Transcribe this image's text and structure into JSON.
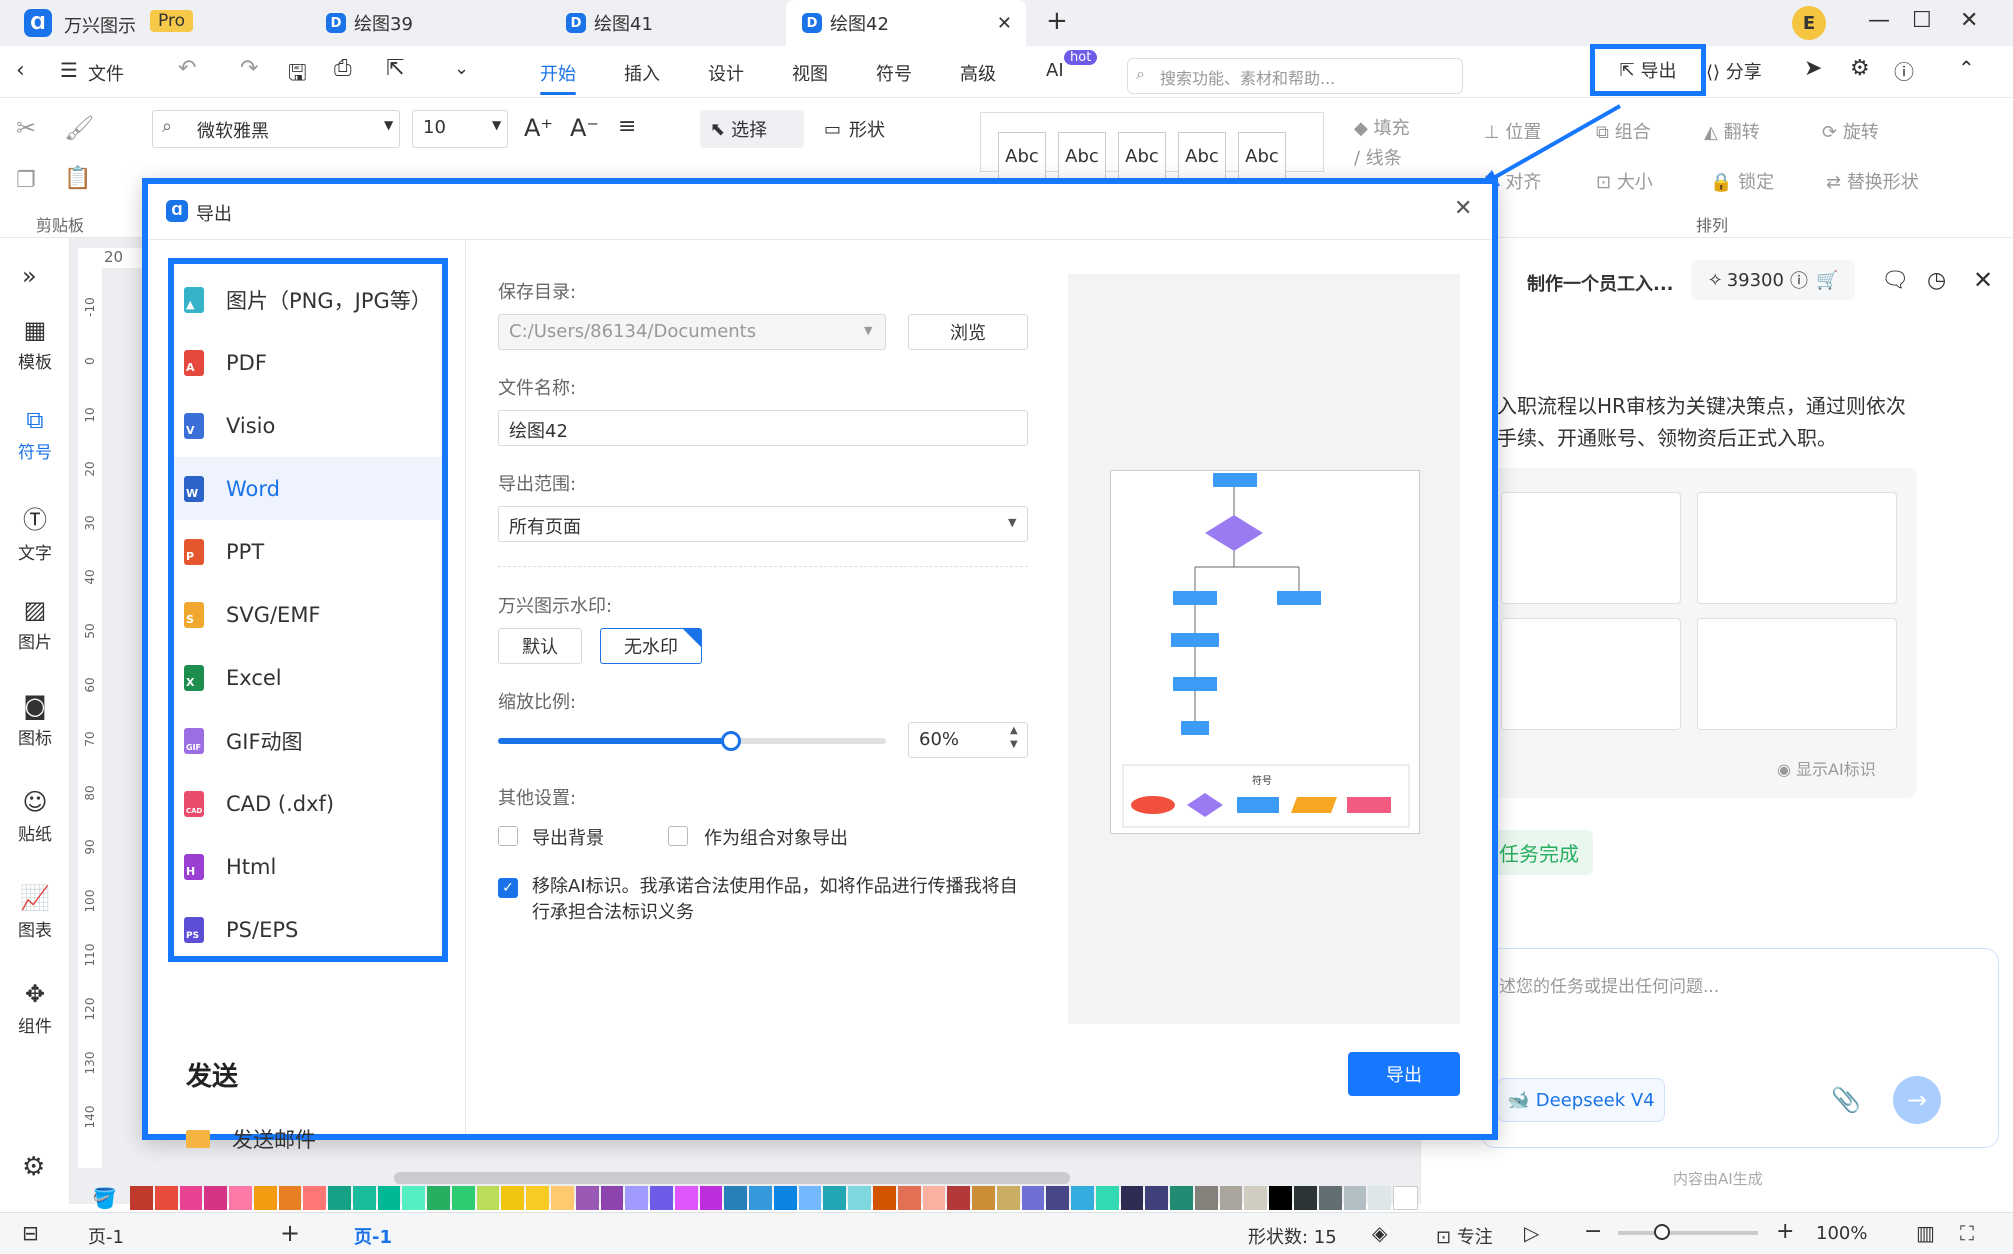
{
  "titlebar": {
    "app_name": "万兴图示",
    "pro_badge": "Pro",
    "tabs": [
      {
        "label": "绘图39"
      },
      {
        "label": "绘图41"
      },
      {
        "label": "绘图42"
      }
    ],
    "new_tab": "+",
    "avatar": "E"
  },
  "menubar": {
    "file": "文件",
    "items": [
      "开始",
      "插入",
      "设计",
      "视图",
      "符号",
      "高级",
      "AI"
    ],
    "hot_badge": "hot",
    "search_placeholder": "搜索功能、素材和帮助...",
    "export": "导出",
    "share": "分享"
  },
  "ribbon": {
    "clipboard": "剪贴板",
    "font_name": "微软雅黑",
    "font_size": "10",
    "select": "选择",
    "shape": "形状",
    "style_samples": [
      "Abc",
      "Abc",
      "Abc",
      "Abc",
      "Abc"
    ],
    "fill": "填充",
    "line": "线条",
    "position": "位置",
    "group": "组合",
    "flip": "翻转",
    "rotate": "旋转",
    "align": "对齐",
    "size": "大小",
    "lock": "锁定",
    "replace_shape": "替换形状",
    "arrange": "排列"
  },
  "leftbar": {
    "items": [
      "模板",
      "符号",
      "文字",
      "图片",
      "图标",
      "贴纸",
      "图表",
      "组件"
    ]
  },
  "ruler": {
    "top_label": "20",
    "marks": [
      "-10",
      "0",
      "10",
      "20",
      "30",
      "40",
      "50",
      "60",
      "70",
      "80",
      "90",
      "100",
      "110",
      "120",
      "130",
      "140"
    ]
  },
  "dialog": {
    "title": "导出",
    "formats": [
      "图片（PNG，JPG等）",
      "PDF",
      "Visio",
      "Word",
      "PPT",
      "SVG/EMF",
      "Excel",
      "GIF动图",
      "CAD (.dxf)",
      "Html",
      "PS/EPS"
    ],
    "send_heading": "发送",
    "send_email": "发送邮件",
    "save_dir_label": "保存目录:",
    "save_dir_value": "C:/Users/86134/Documents",
    "browse": "浏览",
    "filename_label": "文件名称:",
    "filename_value": "绘图42",
    "range_label": "导出范围:",
    "range_value": "所有页面",
    "watermark_label": "万兴图示水印:",
    "watermark_default": "默认",
    "watermark_none": "无水印",
    "scale_label": "缩放比例:",
    "scale_value": "60%",
    "scale_fraction": 0.6,
    "other_label": "其他设置:",
    "export_bg": "导出背景",
    "export_group": "作为组合对象导出",
    "remove_ai": "移除AI标识。我承诺合法使用作品，如将作品进行传播我将自行承担合法标识义务",
    "export_button": "导出",
    "preview_legend_title": "符号"
  },
  "rightpanel": {
    "title": "制作一个员工入...",
    "credits": "39300",
    "message_line1": "入职流程以HR审核为关键决策点，通过则依次",
    "message_line2": "手续、开通账号、领物资后正式入职。",
    "show_ai": "显示AI标识",
    "task_done": "任务完成",
    "input_placeholder": "述您的任务或提出任何问题...",
    "model": "Deepseek V4",
    "footer": "内容由AI生成"
  },
  "statusbar": {
    "page_selector": "页-1",
    "add_page": "+",
    "current_page": "页-1",
    "shape_count": "形状数: 15",
    "focus": "专注",
    "zoom": "100%"
  },
  "colors": {
    "accent": "#1677ff",
    "palette": [
      "#c0392b",
      "#e74c3c",
      "#e84393",
      "#d63384",
      "#fd79a8",
      "#f39c12",
      "#e67e22",
      "#ff7675",
      "#16a085",
      "#1abc9c",
      "#00b894",
      "#55efc4",
      "#27ae60",
      "#2ecc71",
      "#badc58",
      "#f1c40f",
      "#f9ca24",
      "#fdcb6e",
      "#9b59b6",
      "#8e44ad",
      "#a29bfe",
      "#6c5ce7",
      "#e056fd",
      "#be2edd",
      "#2980b9",
      "#3498db",
      "#0984e3",
      "#74b9ff",
      "#22a6b3",
      "#7ed6df",
      "#d35400",
      "#e17055",
      "#fab1a0",
      "#b33939",
      "#cc8e35",
      "#ccae62",
      "#706fd3",
      "#474787",
      "#34ace0",
      "#33d9b2",
      "#2c2c54",
      "#40407a",
      "#218c74",
      "#84817a",
      "#aaa69d",
      "#d1ccc0",
      "#000000",
      "#2d3436",
      "#636e72",
      "#b2bec3",
      "#dfe6e9",
      "#ffffff"
    ]
  }
}
